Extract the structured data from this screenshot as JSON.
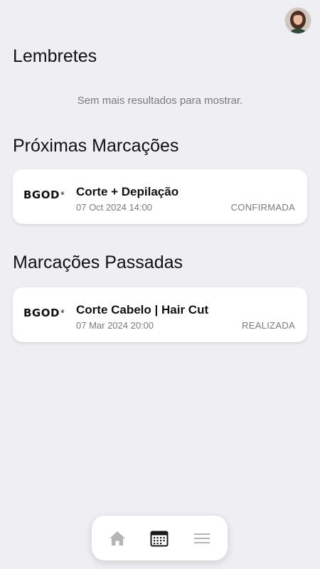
{
  "header": {
    "avatar_icon": "user-avatar"
  },
  "reminders": {
    "title": "Lembretes",
    "empty_message": "Sem mais resultados para mostrar."
  },
  "upcoming": {
    "title": "Próximas Marcações",
    "items": [
      {
        "logo_text": "BGOD",
        "logo_mark": "®",
        "service": "Corte + Depilação",
        "datetime": "07 Oct 2024 14:00",
        "status": "CONFIRMADA"
      }
    ]
  },
  "past": {
    "title": "Marcações Passadas",
    "items": [
      {
        "logo_text": "BGOD",
        "logo_mark": "®",
        "service": "Corte Cabelo | Hair Cut",
        "datetime": "07 Mar 2024 20:00",
        "status": "REALIZADA"
      }
    ]
  },
  "nav": {
    "items": [
      {
        "icon": "home-icon",
        "active": false
      },
      {
        "icon": "calendar-icon",
        "active": true
      },
      {
        "icon": "menu-icon",
        "active": false
      }
    ]
  },
  "colors": {
    "background": "#efeef3",
    "card": "#ffffff",
    "muted_text": "#7a7a7e",
    "active_icon": "#1a1a1a",
    "inactive_icon": "#b5b5b8"
  }
}
